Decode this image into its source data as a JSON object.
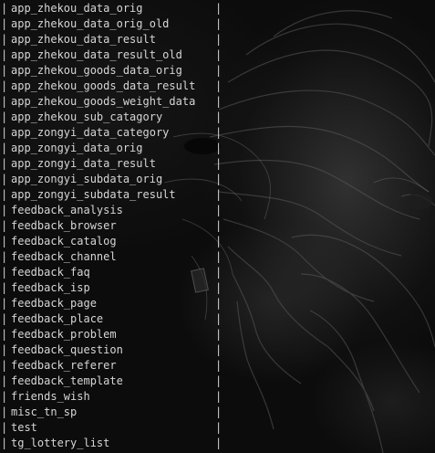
{
  "terminal": {
    "rows": [
      "app_zhekou_data_orig",
      "app_zhekou_data_orig_old",
      "app_zhekou_data_result",
      "app_zhekou_data_result_old",
      "app_zhekou_goods_data_orig",
      "app_zhekou_goods_data_result",
      "app_zhekou_goods_weight_data",
      "app_zhekou_sub_catagory",
      "app_zongyi_data_category",
      "app_zongyi_data_orig",
      "app_zongyi_data_result",
      "app_zongyi_subdata_orig",
      "app_zongyi_subdata_result",
      "feedback_analysis",
      "feedback_browser",
      "feedback_catalog",
      "feedback_channel",
      "feedback_faq",
      "feedback_isp",
      "feedback_page",
      "feedback_place",
      "feedback_problem",
      "feedback_question",
      "feedback_referer",
      "feedback_template",
      "friends_wish",
      "misc_tn_sp",
      "test",
      "tg_lottery_list"
    ],
    "separator": "|"
  }
}
